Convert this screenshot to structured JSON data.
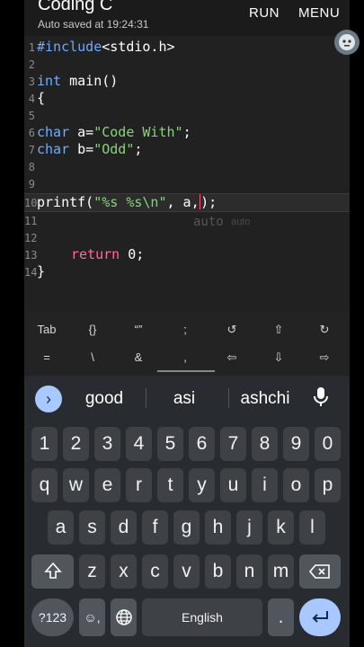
{
  "header": {
    "title": "Coding C",
    "subtitle": "Auto saved at 19:24:31",
    "run_label": "RUN",
    "menu_label": "MENU"
  },
  "editor": {
    "lines": [
      {
        "n": "1"
      },
      {
        "n": "2"
      },
      {
        "n": "3"
      },
      {
        "n": "4"
      },
      {
        "n": "5"
      },
      {
        "n": "6"
      },
      {
        "n": "7"
      },
      {
        "n": "8"
      },
      {
        "n": "9"
      },
      {
        "n": "10"
      },
      {
        "n": "11"
      },
      {
        "n": "12"
      },
      {
        "n": "13"
      },
      {
        "n": "14"
      }
    ],
    "code": {
      "l1a": "#include",
      "l1b": "<stdio.h>",
      "l3a": "int",
      "l3b": " main()",
      "l4": "{",
      "l6a": "char",
      "l6b": " a=",
      "l6c": "\"Code With\"",
      "l6d": ";",
      "l7a": "char",
      "l7b": " b=",
      "l7c": "\"Odd\"",
      "l7d": ";",
      "l10a": "printf(",
      "l10b": "\"%s %s\\n\"",
      "l10c": ", a,",
      "l10d": ");",
      "l13a": "return",
      "l13b": " 0;",
      "l14": "}"
    },
    "ghost_suggestion": "auto",
    "ghost_suggestion_2": "auto"
  },
  "extra_keys": {
    "row1": [
      "Tab",
      "{}",
      "“”",
      ";",
      "↺",
      "⇧",
      "↻"
    ],
    "row2": [
      "=",
      "\\",
      "&",
      ",",
      "⇦",
      "⇩",
      "⇨"
    ]
  },
  "keyboard": {
    "suggestions": [
      "good",
      "asi",
      "ashchi"
    ],
    "numbers": [
      "1",
      "2",
      "3",
      "4",
      "5",
      "6",
      "7",
      "8",
      "9",
      "0"
    ],
    "row1": [
      "q",
      "w",
      "e",
      "r",
      "t",
      "y",
      "u",
      "i",
      "o",
      "p"
    ],
    "row2": [
      "a",
      "s",
      "d",
      "f",
      "g",
      "h",
      "j",
      "k",
      "l"
    ],
    "row3": [
      "z",
      "x",
      "c",
      "v",
      "b",
      "n",
      "m"
    ],
    "symbols_label": "?123",
    "emoji_label": "☺,",
    "space_label": "English",
    "period_label": ".",
    "shift_icon": "shift-icon",
    "backspace_icon": "backspace-icon",
    "enter_icon": "enter-icon",
    "globe_icon": "globe-icon"
  }
}
